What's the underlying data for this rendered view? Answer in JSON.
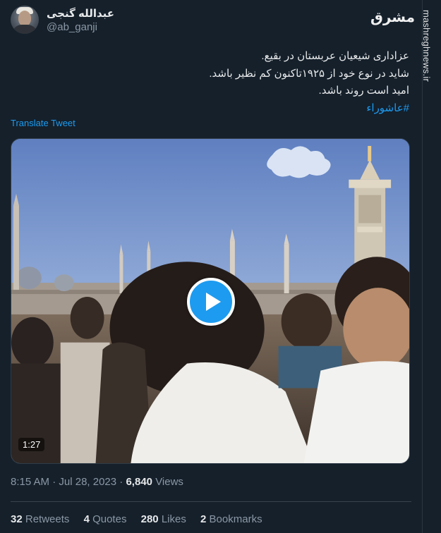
{
  "author": {
    "display_name": "عبدالله گنجی",
    "handle": "@ab_ganji"
  },
  "tweet": {
    "lines": [
      "عزاداری شیعیان عربستان در بقیع.",
      "شاید در نوع خود از ۱۹۲۵تاکنون کم نظیر باشد.",
      "امید است روند باشد."
    ],
    "hashtag": "#عاشوراء",
    "translate_label": "Translate Tweet"
  },
  "media": {
    "type": "video",
    "duration": "1:27",
    "play_icon": "play-icon"
  },
  "meta": {
    "time": "8:15 AM",
    "separator": " · ",
    "date": "Jul 28, 2023",
    "views_count": "6,840",
    "views_label": "Views"
  },
  "stats": [
    {
      "count": "32",
      "label": "Retweets"
    },
    {
      "count": "4",
      "label": "Quotes"
    },
    {
      "count": "280",
      "label": "Likes"
    },
    {
      "count": "2",
      "label": "Bookmarks"
    }
  ],
  "watermark": {
    "logo_text": "مشرق",
    "url": "mashreghnews.ir"
  },
  "colors": {
    "background": "#15202b",
    "accent": "#1d9bf0",
    "muted": "#8b98a5",
    "text": "#e7e9ea"
  }
}
